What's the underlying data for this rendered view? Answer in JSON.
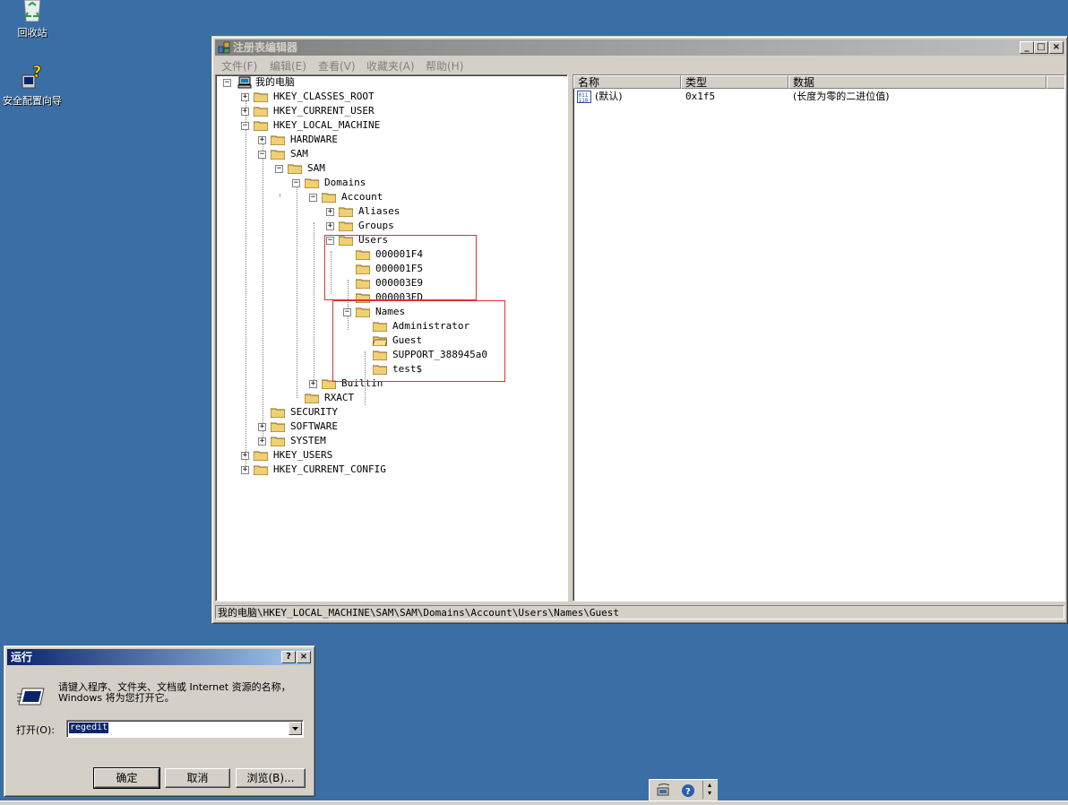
{
  "desktop": {
    "icons": [
      {
        "label": "回收站",
        "icon": "recycle-bin-icon"
      },
      {
        "label": "安全配置向导",
        "icon": "security-wizard-icon"
      }
    ]
  },
  "regedit": {
    "title": "注册表编辑器",
    "menu": [
      "文件(F)",
      "编辑(E)",
      "查看(V)",
      "收藏夹(A)",
      "帮助(H)"
    ],
    "tree": {
      "root": "我的电脑",
      "hkcr": "HKEY_CLASSES_ROOT",
      "hkcu": "HKEY_CURRENT_USER",
      "hklm": "HKEY_LOCAL_MACHINE",
      "hardware": "HARDWARE",
      "sam1": "SAM",
      "sam2": "SAM",
      "domains": "Domains",
      "account": "Account",
      "aliases": "Aliases",
      "groups": "Groups",
      "users": "Users",
      "u1": "000001F4",
      "u2": "000001F5",
      "u3": "000003E9",
      "u4": "000003ED",
      "names": "Names",
      "n1": "Administrator",
      "n2": "Guest",
      "n3": "SUPPORT_388945a0",
      "n4": "test$",
      "builtin": "Builtin",
      "rxact": "RXACT",
      "security": "SECURITY",
      "software": "SOFTWARE",
      "system": "SYSTEM",
      "hku": "HKEY_USERS",
      "hkcc": "HKEY_CURRENT_CONFIG"
    },
    "columns": [
      "名称",
      "类型",
      "数据"
    ],
    "values": [
      {
        "name": "(默认)",
        "type": "0x1f5",
        "data": "(长度为零的二进位值)"
      }
    ],
    "status": "我的电脑\\HKEY_LOCAL_MACHINE\\SAM\\SAM\\Domains\\Account\\Users\\Names\\Guest"
  },
  "run": {
    "title": "运行",
    "description": "请键入程序、文件夹、文档或 Internet 资源的名称，Windows 将为您打开它。",
    "open_label": "打开(O):",
    "input_value": "regedit",
    "ok": "确定",
    "cancel": "取消",
    "browse": "浏览(B)..."
  }
}
